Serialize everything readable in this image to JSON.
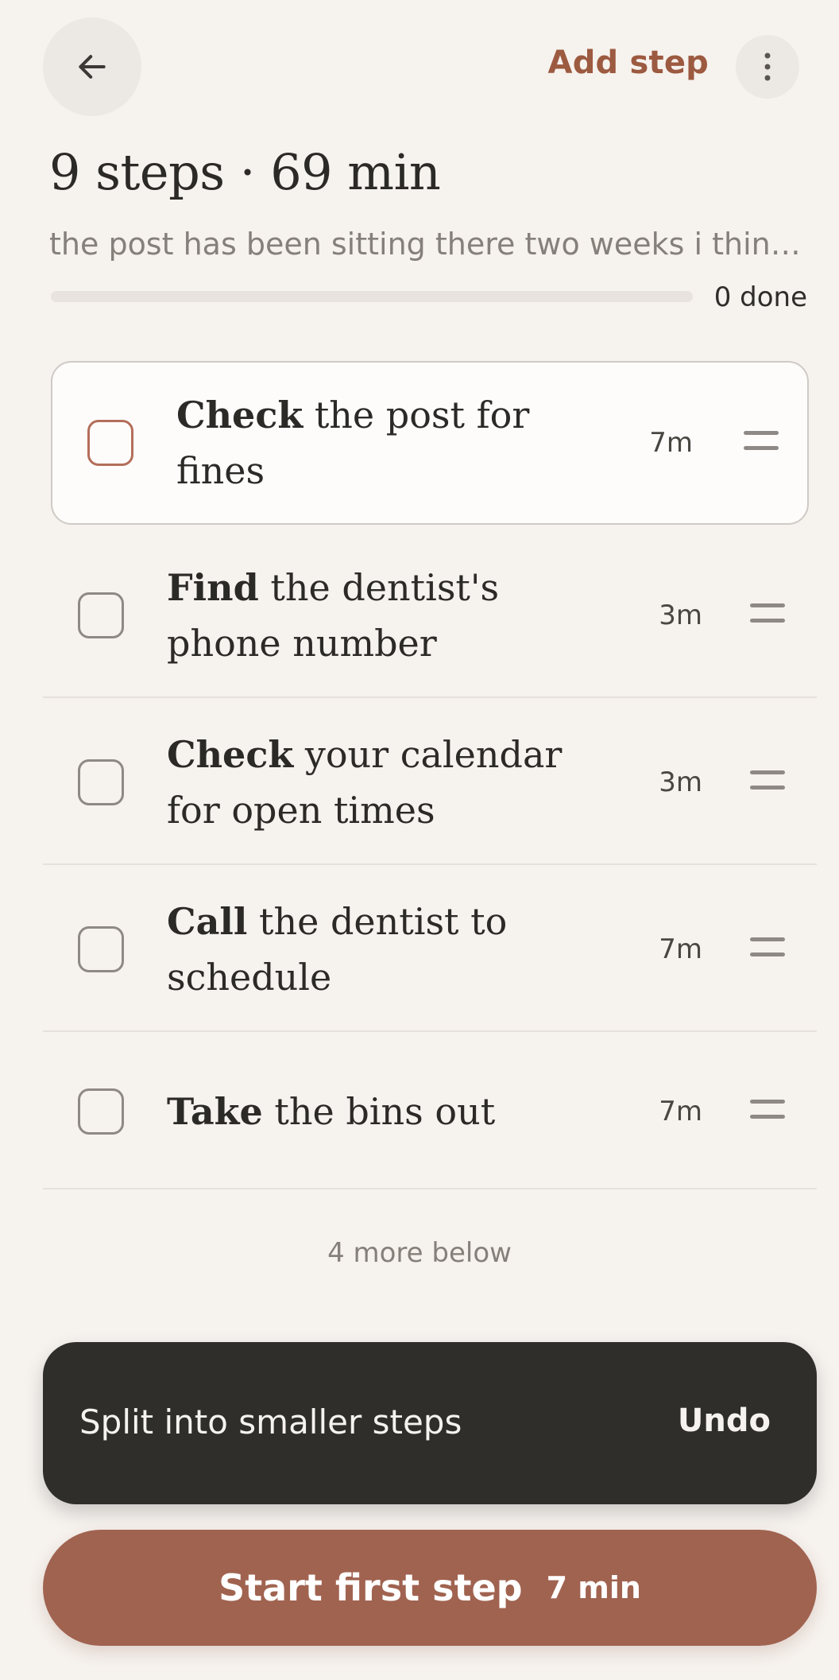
{
  "header": {
    "add_step_label": "Add step"
  },
  "summary": {
    "title": "9 steps · 69 min",
    "subtitle": "the post has been sitting there two weeks i think o...",
    "done_label": "0 done",
    "progress": 0
  },
  "steps": [
    {
      "verb": "Check",
      "rest": " the post for fines",
      "duration": "7m"
    },
    {
      "verb": "Find",
      "rest": " the dentist's phone number",
      "duration": "3m"
    },
    {
      "verb": "Check",
      "rest": " your calendar for open times",
      "duration": "3m"
    },
    {
      "verb": "Call",
      "rest": " the dentist to schedule",
      "duration": "7m"
    },
    {
      "verb": "Take",
      "rest": " the bins out",
      "duration": "7m"
    }
  ],
  "more_below": "4 more below",
  "snackbar": {
    "message": "Split into smaller steps",
    "action": "Undo"
  },
  "start_button": {
    "label": "Start first step",
    "duration": "7 min"
  },
  "colors": {
    "accent": "#a06350",
    "background": "#f6f2ee",
    "snackbar": "#2f2e2b"
  },
  "icons": {
    "back": "arrow-left-icon",
    "more": "more-vertical-icon",
    "drag": "drag-handle-icon"
  }
}
